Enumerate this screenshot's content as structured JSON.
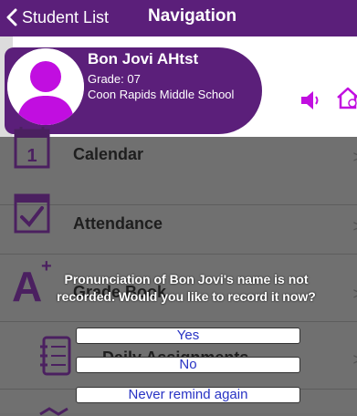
{
  "navbar": {
    "back_label": "Student List",
    "title": "Navigation"
  },
  "student": {
    "name": "Bon Jovi AHtst",
    "grade": "Grade: 07",
    "school": "Coon Rapids Middle School"
  },
  "header_icons": [
    "speaker-icon",
    "house-icon"
  ],
  "menu": {
    "items": [
      {
        "label": "Calendar",
        "icon": "calendar-icon"
      },
      {
        "label": "Attendance",
        "icon": "attendance-icon"
      },
      {
        "label": "Grade Book",
        "icon": "grade-book-icon"
      },
      {
        "label": "Daily Assignments",
        "icon": "assignments-icon"
      }
    ],
    "chevron": ">"
  },
  "dialog": {
    "message": "Pronunciation of Bon Jovi's name is not recorded. Would you like to record it now?",
    "buttons": [
      "Yes",
      "No",
      "Never remind again"
    ]
  },
  "colors": {
    "brand_purple": "#5b1f7a",
    "avatar_magenta": "#c10ee0",
    "icon_purple": "#4b2060",
    "dialog_button_text": "#2833c4",
    "overlay_gray": "#707070"
  }
}
